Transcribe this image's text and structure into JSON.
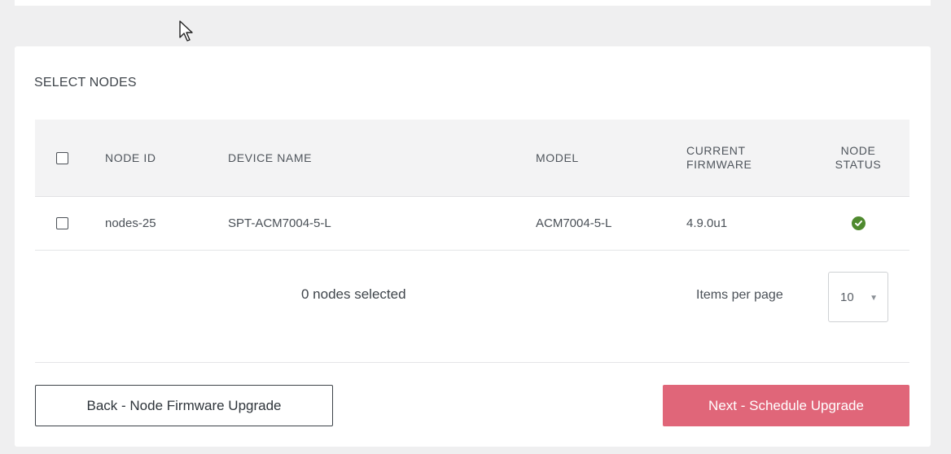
{
  "section": {
    "title": "SELECT NODES"
  },
  "table": {
    "headers": {
      "node_id": "NODE ID",
      "device_name": "DEVICE NAME",
      "model": "MODEL",
      "current_firmware_line1": "CURRENT",
      "current_firmware_line2": "FIRMWARE",
      "node_status_line1": "NODE",
      "node_status_line2": "STATUS"
    },
    "rows": [
      {
        "node_id": "nodes-25",
        "device_name": "SPT-ACM7004-5-L",
        "model": "ACM7004-5-L",
        "firmware": "4.9.0u1",
        "status": "ok",
        "status_icon": "check-circle-icon",
        "checked": false
      }
    ]
  },
  "footer": {
    "selected_count": "0 nodes selected",
    "items_per_page_label": "Items per page",
    "items_per_page_value": "10"
  },
  "buttons": {
    "back_label": "Back - Node Firmware Upgrade",
    "next_label": "Next - Schedule Upgrade"
  },
  "colors": {
    "accent": "#e06679",
    "status_ok": "#4f8a2e"
  }
}
